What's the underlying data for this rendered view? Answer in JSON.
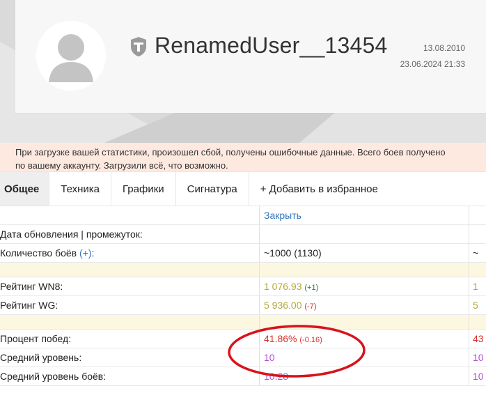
{
  "profile": {
    "username": "RenamedUser__13454",
    "registered_date": "13.08.2010",
    "updated_datetime": "23.06.2024 21:33"
  },
  "warning": {
    "line1": "При загрузке вашей статистики, произошел сбой, получены ошибочные данные. Всего боев получено",
    "line2": "по вашему аккаунту. Загрузили всё, что возможно."
  },
  "tabs": [
    {
      "label": "Общее"
    },
    {
      "label": "Техника"
    },
    {
      "label": "Графики"
    },
    {
      "label": "Сигнатура"
    },
    {
      "label": "+ Добавить в избранное"
    }
  ],
  "stats": {
    "close_label": "Закрыть",
    "rows": {
      "update_date": {
        "label": "Дата обновления | промежуток:"
      },
      "battles": {
        "label": "Количество боёв",
        "plus": "(+)",
        "colon": ":",
        "value": "~1000 (1130)",
        "col3": "~"
      },
      "wn8": {
        "label": "Рейтинг WN8:",
        "value": "1 076.93",
        "delta": "(+1)",
        "col3": "1"
      },
      "wg": {
        "label": "Рейтинг WG:",
        "value": "5 936.00",
        "delta": "(-7)",
        "col3": "5"
      },
      "winrate": {
        "label": "Процент побед:",
        "value": "41.86%",
        "delta": "(-0.16)",
        "col3": "43"
      },
      "avg_tier": {
        "label": "Средний уровень:",
        "value": "10",
        "col3": "10"
      },
      "avg_battle_tier": {
        "label": "Средний уровень боёв:",
        "value": "10.28",
        "col3": "10"
      }
    }
  },
  "colors": {
    "accent_link": "#3377bb",
    "warning_bg": "#fde9e0",
    "spacer_bg": "#fcf7e1",
    "rating_yellow": "#b4a93a",
    "winrate_red": "#d9302b",
    "tier_purple": "#b24fd6",
    "annotation_red": "#d8131b"
  }
}
